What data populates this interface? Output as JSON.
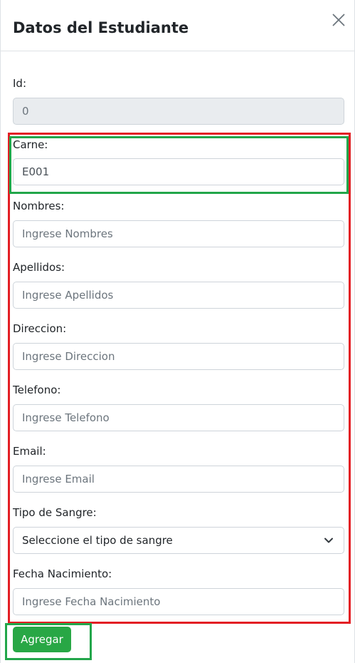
{
  "modal": {
    "title": "Datos del Estudiante",
    "close_icon": "close-icon"
  },
  "form": {
    "id": {
      "label": "Id:",
      "value": "0"
    },
    "carne": {
      "label": "Carne:",
      "value": "E001"
    },
    "nombres": {
      "label": "Nombres:",
      "placeholder": "Ingrese Nombres"
    },
    "apellidos": {
      "label": "Apellidos:",
      "placeholder": "Ingrese Apellidos"
    },
    "direccion": {
      "label": "Direccion:",
      "placeholder": "Ingrese Direccion"
    },
    "telefono": {
      "label": "Telefono:",
      "placeholder": "Ingrese Telefono"
    },
    "email": {
      "label": "Email:",
      "placeholder": "Ingrese Email"
    },
    "tipo_sangre": {
      "label": "Tipo de Sangre:",
      "selected": "Seleccione el tipo de sangre",
      "icon": "chevron-down-icon"
    },
    "fecha_nacimiento": {
      "label": "Fecha Nacimiento:",
      "placeholder": "Ingrese Fecha Nacimiento"
    },
    "submit_label": "Agregar"
  },
  "colors": {
    "submit_button": "#28a745",
    "highlight_red": "#e31e24",
    "highlight_green": "#22a64a",
    "readonly_field": "#e9ecef"
  }
}
